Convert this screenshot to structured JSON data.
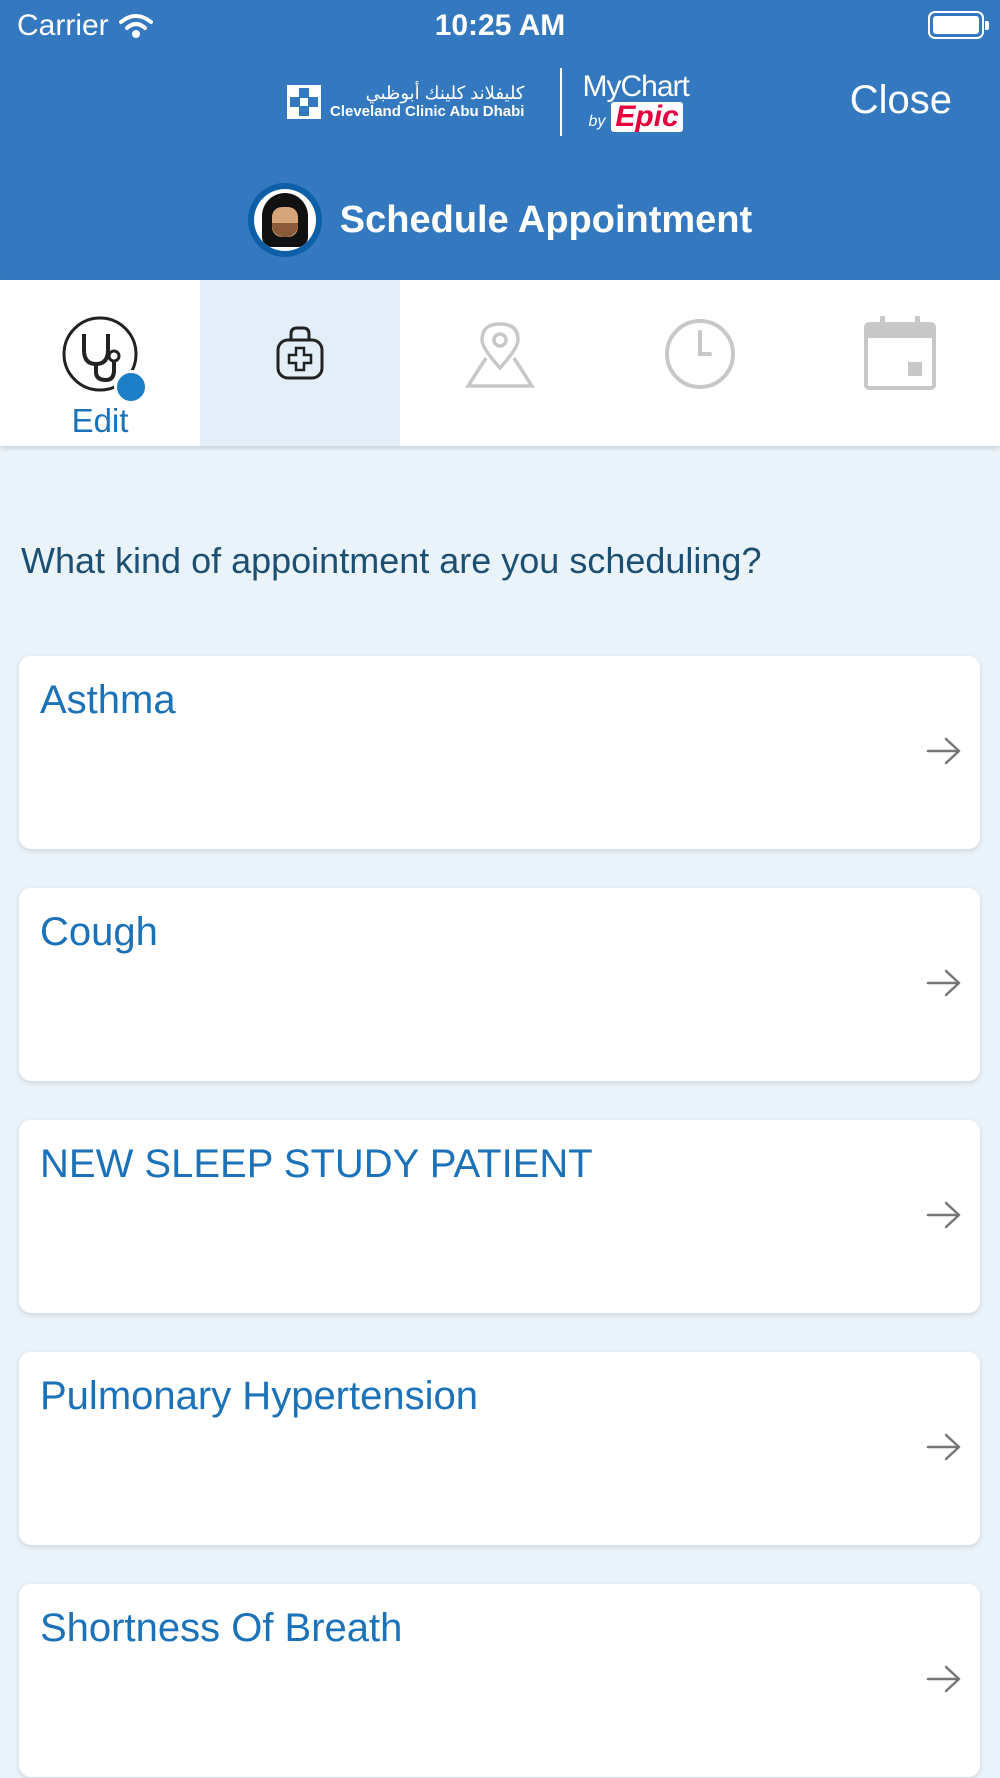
{
  "status_bar": {
    "carrier": "Carrier",
    "time": "10:25 AM"
  },
  "header": {
    "logo_arabic": "كليفلاند كلينك أبوظبي",
    "logo_english": "Cleveland Clinic Abu Dhabi",
    "mychart_name": "MyChart",
    "mychart_by": "by",
    "epic": "Epic",
    "close_label": "Close",
    "title": "Schedule Appointment"
  },
  "steps": [
    {
      "icon": "stethoscope-icon",
      "label": "Edit",
      "state": "completed"
    },
    {
      "icon": "medical-bag-icon",
      "label": "",
      "state": "current"
    },
    {
      "icon": "map-pin-icon",
      "label": "",
      "state": "upcoming"
    },
    {
      "icon": "clock-icon",
      "label": "",
      "state": "upcoming"
    },
    {
      "icon": "calendar-icon",
      "label": "",
      "state": "upcoming"
    }
  ],
  "main": {
    "question": "What kind of appointment are you scheduling?",
    "options": [
      {
        "label": "Asthma"
      },
      {
        "label": "Cough"
      },
      {
        "label": "NEW SLEEP STUDY PATIENT"
      },
      {
        "label": "Pulmonary Hypertension"
      },
      {
        "label": "Shortness Of Breath"
      }
    ]
  },
  "colors": {
    "header_bg": "#3479bf",
    "accent": "#1b72b8",
    "page_bg": "#eaf3fa",
    "step_active_bg": "#e3eef8",
    "epic_red": "#e4003b"
  }
}
